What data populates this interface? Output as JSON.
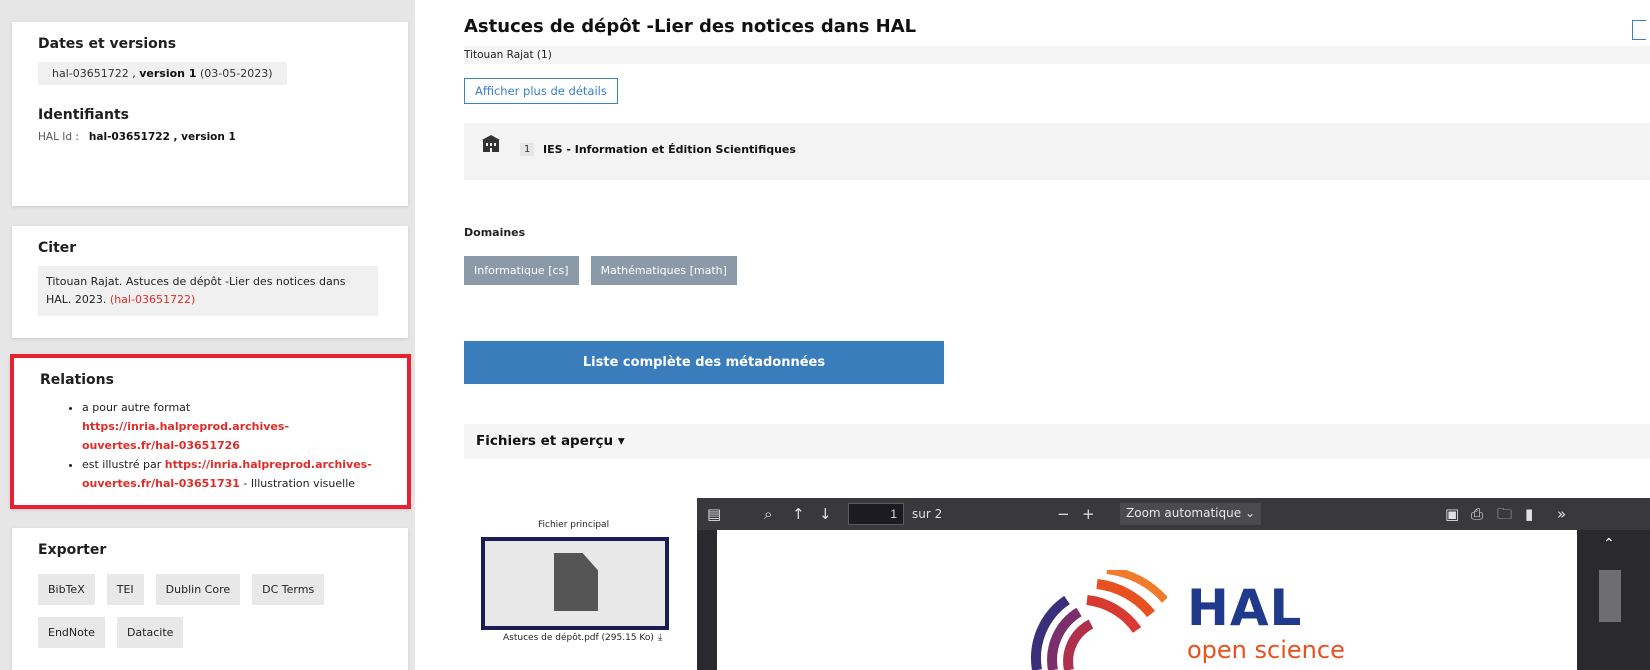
{
  "sidebar": {
    "dates": {
      "title": "Dates et versions",
      "version_id": "hal-03651722",
      "version_sep": " , ",
      "version_label": "version 1",
      "version_date": "(03-05-2023)"
    },
    "identifiants": {
      "title": "Identifiants",
      "halid_label": "HAL Id :",
      "halid_value": "hal-03651722 , version 1"
    },
    "citer": {
      "title": "Citer",
      "text": "Titouan Rajat. Astuces de dépôt -Lier des notices dans HAL. 2023.",
      "ref": "(hal-03651722)"
    },
    "relations": {
      "title": "Relations",
      "items": [
        {
          "prefix": "a pour autre format ",
          "link": "https://inria.halpreprod.archives-ouvertes.fr/hal-03651726",
          "suffix": ""
        },
        {
          "prefix": "est illustré par ",
          "link": "https://inria.halpreprod.archives-ouvertes.fr/hal-03651731",
          "suffix": " - Illustration visuelle"
        }
      ]
    },
    "exporter": {
      "title": "Exporter",
      "buttons": [
        "BibTeX",
        "TEI",
        "Dublin Core",
        "DC Terms",
        "EndNote",
        "Datacite"
      ]
    }
  },
  "main": {
    "title": "Astuces de dépôt -Lier des notices dans HAL",
    "authors": "Titouan Rajat (1)",
    "details_button": "Afficher plus de détails",
    "affiliation": {
      "num": "1",
      "name": "IES - Information et Édition Scientifiques"
    },
    "domaines_label": "Domaines",
    "domaines": [
      "Informatique [cs]",
      "Mathématiques [math]"
    ],
    "metadata_button": "Liste complète des métadonnées",
    "files_header": "Fichiers et aperçu",
    "files_caret": "▾",
    "file_main_label": "Fichier principal",
    "file_name": "Astuces de dépôt.pdf (295.15 Ko)",
    "viewer": {
      "page_value": "1",
      "page_of": "sur 2",
      "zoom": "Zoom automatique",
      "logo_title": "HAL",
      "logo_subtitle": "open science"
    }
  },
  "colors": {
    "accent_blue": "#3a7dbd",
    "relation_red": "#e02c28",
    "highlight_border": "#e8202f",
    "chip_gray": "#8a9aa8",
    "hal_blue": "#1f3a8a",
    "hal_orange": "#e8501f"
  }
}
